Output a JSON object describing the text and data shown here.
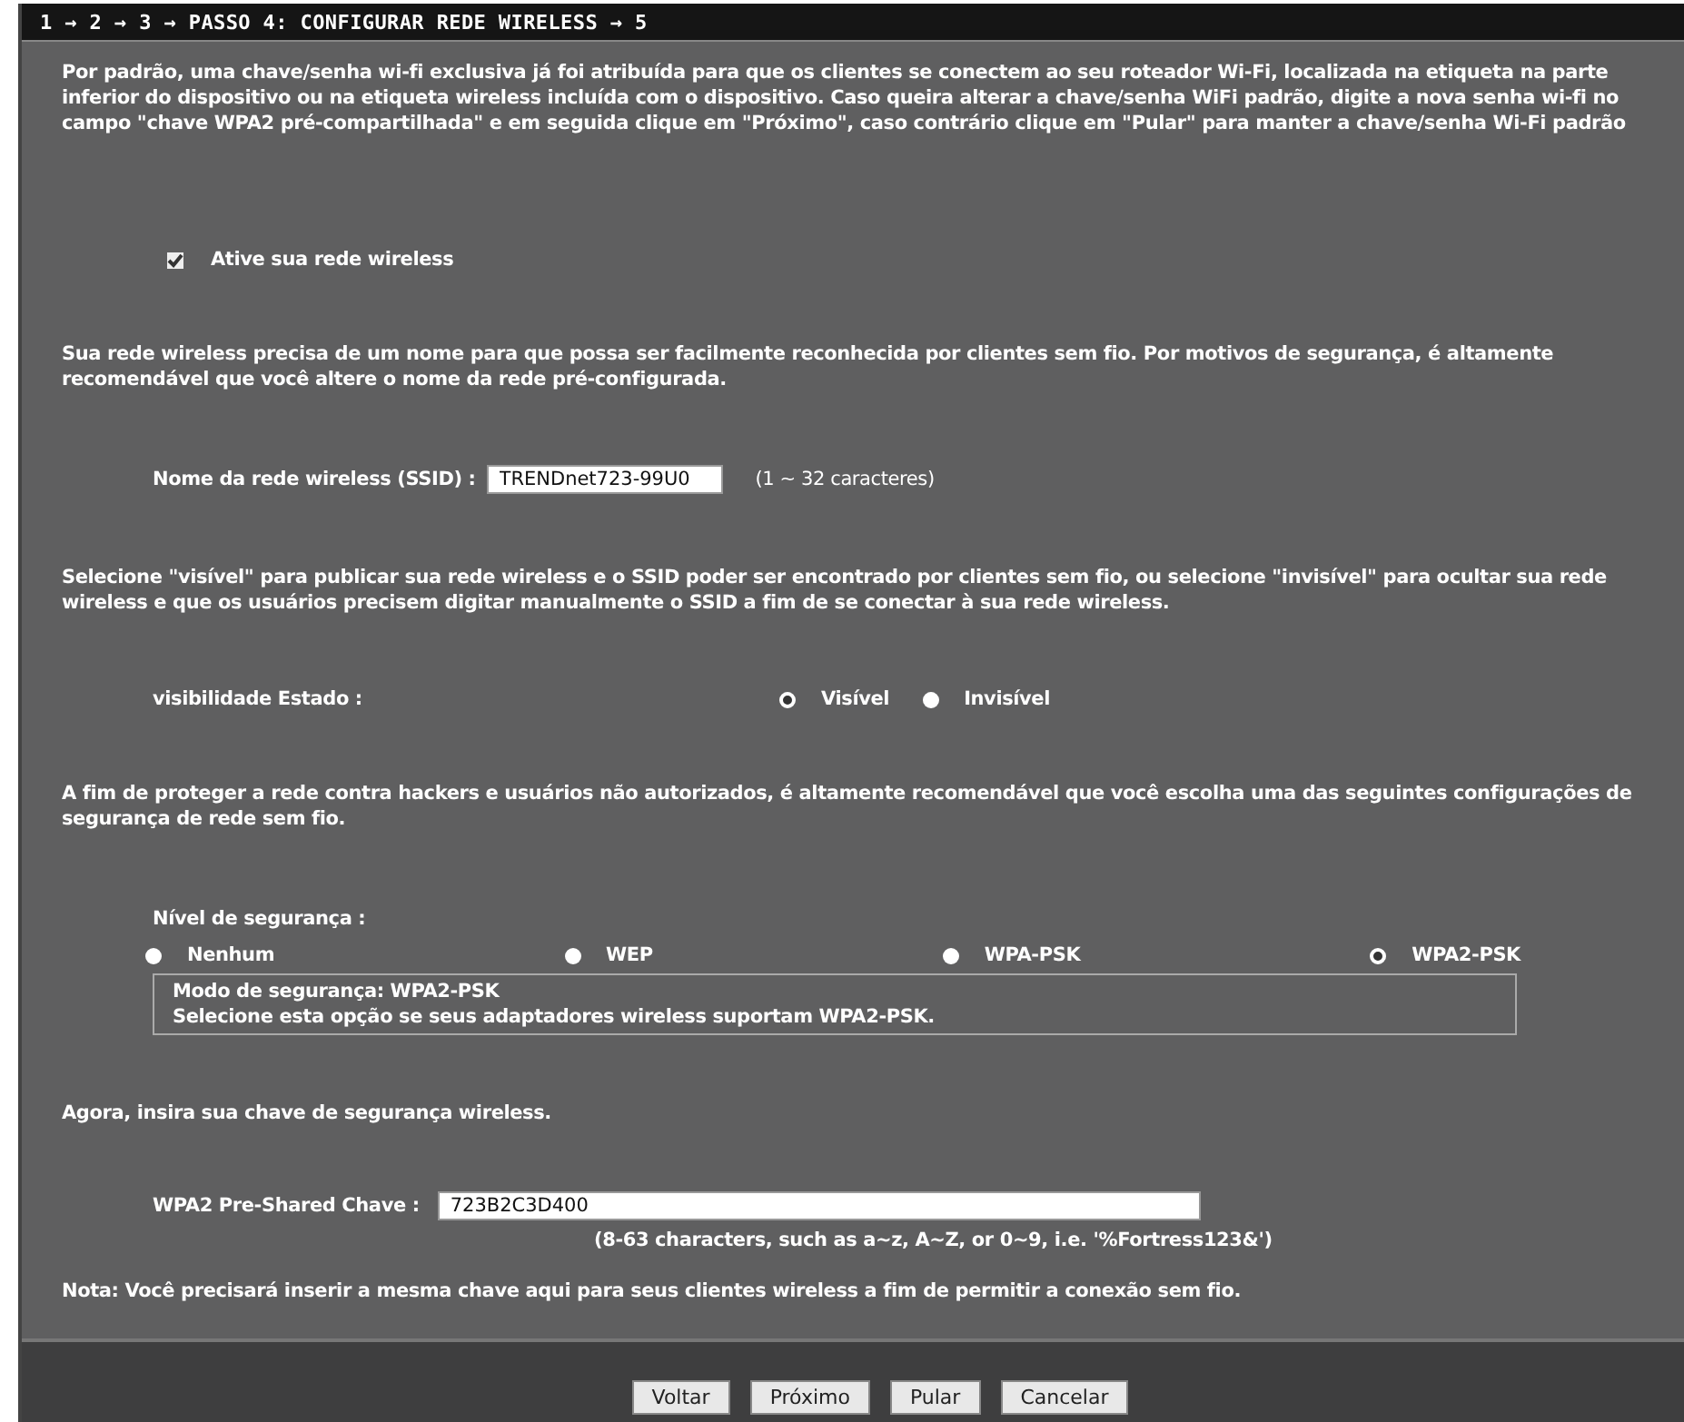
{
  "header": {
    "title": "1 → 2 → 3 → PASSO 4: CONFIGURAR REDE WIRELESS → 5"
  },
  "intro": "Por padrão, uma chave/senha wi-fi exclusiva já foi atribuída para que os clientes se conectem ao seu roteador Wi-Fi, localizada na etiqueta na parte inferior do dispositivo ou na etiqueta wireless incluída com o dispositivo. Caso queira alterar a chave/senha WiFi padrão, digite a nova senha wi-fi no campo \"chave WPA2 pré-compartilhada\" e em seguida clique em \"Próximo\", caso contrário clique em \"Pular\" para manter a chave/senha Wi-Fi padrão",
  "enable": {
    "label": "Ative sua rede wireless",
    "checked": true
  },
  "ssid_text": "Sua rede wireless precisa de um nome para que possa ser facilmente reconhecida por clientes sem fio. Por motivos de segurança, é altamente recomendável que você altere o nome da rede pré-configurada.",
  "ssid": {
    "label": "Nome da rede wireless (SSID) :",
    "value": "TRENDnet723-99U0",
    "hint": "(1 ~ 32 caracteres)"
  },
  "visibility_text": "Selecione \"visível\" para publicar sua rede wireless e o SSID poder ser encontrado por clientes sem fio, ou selecione \"invisível\" para ocultar sua rede wireless e que os usuários precisem digitar manualmente o SSID a fim de se conectar à sua rede wireless.",
  "visibility": {
    "label": "visibilidade Estado :",
    "options": [
      {
        "label": "Visível",
        "selected": true
      },
      {
        "label": "Invisível",
        "selected": false
      }
    ]
  },
  "security_text": "A fim de proteger a rede contra hackers e usuários não autorizados, é altamente recomendável que você escolha uma das seguintes configurações de segurança de rede sem fio.",
  "security": {
    "label": "Nível de segurança :",
    "options": [
      {
        "label": "Nenhum",
        "selected": false
      },
      {
        "label": "WEP",
        "selected": false
      },
      {
        "label": "WPA-PSK",
        "selected": false
      },
      {
        "label": "WPA2-PSK",
        "selected": true
      }
    ],
    "info": [
      "Modo de segurança: WPA2-PSK",
      "Selecione esta opção se seus adaptadores wireless suportam WPA2-PSK."
    ]
  },
  "key_text": "Agora, insira sua chave de segurança wireless.",
  "key": {
    "label": "WPA2 Pre-Shared Chave :",
    "value": "723B2C3D400",
    "hint": "(8-63 characters, such as a~z, A~Z, or 0~9, i.e. '%Fortress123&')"
  },
  "note": "Nota: Você precisará inserir a mesma chave aqui para seus clientes wireless a fim de permitir a conexão sem fio.",
  "buttons": [
    "Voltar",
    "Próximo",
    "Pular",
    "Cancelar"
  ]
}
